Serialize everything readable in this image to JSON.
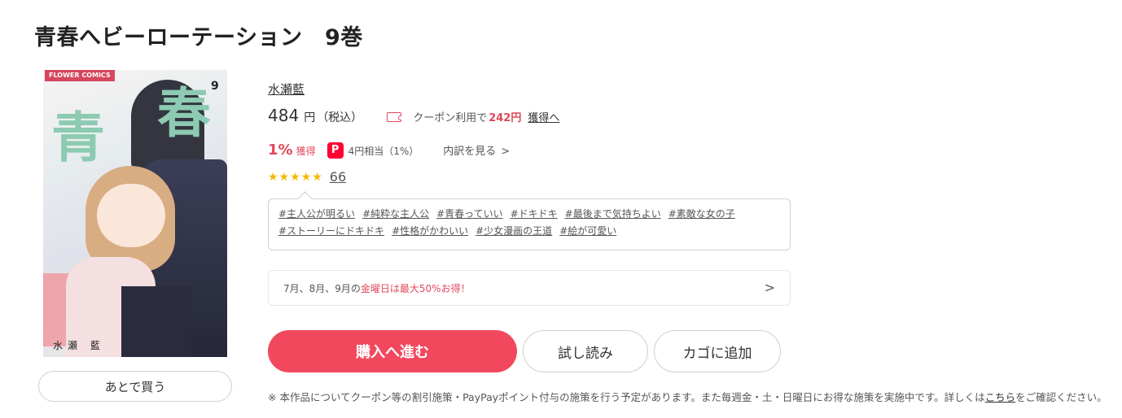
{
  "product": {
    "title": "青春へビーローテーション　9巻",
    "author": "水瀬藍",
    "cover": {
      "label_badge": "FLOWER COMICS",
      "title_kanji_1": "青",
      "title_kanji_2": "春",
      "volume": "9",
      "author_on_cover": "水瀬 藍"
    }
  },
  "price": {
    "amount": "484",
    "unit": "円",
    "tax_note": "（税込）",
    "coupon_text": "クーポン利用で",
    "coupon_amount": "242円",
    "coupon_link": "獲得へ"
  },
  "points": {
    "percent": "1%",
    "label": "獲得",
    "paypay_glyph": "P",
    "equivalent": "4円相当（1%）",
    "detail_link": "内訳を見る"
  },
  "rating": {
    "stars": "★★★★★",
    "value": 4.5,
    "count": "66"
  },
  "tags": [
    "#主人公が明るい",
    "#純粋な主人公",
    "#青春っていい",
    "#ドキドキ",
    "#最後まで気持ちよい",
    "#素敵な女の子",
    "#ストーリーにドキドキ",
    "#性格がかわいい",
    "#少女漫画の王道",
    "#絵が可愛い"
  ],
  "promo": {
    "text_a": "7月、8月、9月の",
    "text_b": "金曜日は最大50%お得！"
  },
  "actions": {
    "buy": "購入へ進む",
    "trial": "試し読み",
    "cart": "カゴに追加",
    "later": "あとで買う"
  },
  "notice": {
    "text": "※ 本作品についてクーポン等の割引施策・PayPayポイント付与の施策を行う予定があります。また毎週金・土・日曜日にお得な施策を実施中です。詳しくは",
    "link": "こちら",
    "suffix": "をご確認ください。"
  },
  "colors": {
    "accent": "#f2485e",
    "price_red": "#e0485a",
    "star": "#f5b700",
    "paypay": "#ff0033"
  },
  "icons": [
    "coupon-icon",
    "paypay-icon",
    "chevron-right-icon",
    "star-icon"
  ]
}
